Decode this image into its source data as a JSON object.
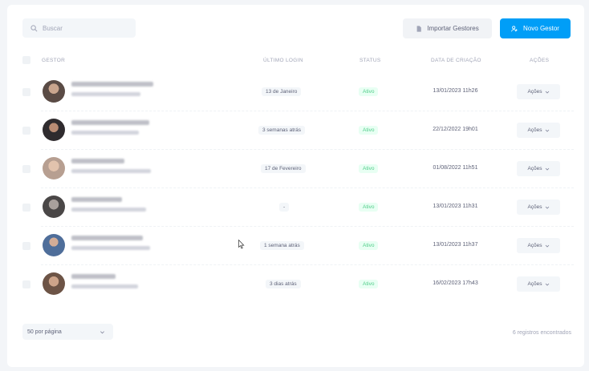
{
  "search": {
    "placeholder": "Buscar"
  },
  "toolbar": {
    "import_label": "Importar Gestores",
    "new_label": "Novo Gestor"
  },
  "table": {
    "headers": {
      "manager": "GESTOR",
      "last_login": "ÚLTIMO LOGIN",
      "status": "STATUS",
      "created": "DATA DE CRIAÇÃO",
      "actions": "AÇÕES"
    },
    "rows": [
      {
        "last_login": "13 de Janeiro",
        "status": "Ativo",
        "created": "13/01/2023 11h26",
        "actions": "Ações"
      },
      {
        "last_login": "3 semanas atrás",
        "status": "Ativo",
        "created": "22/12/2022 19h01",
        "actions": "Ações"
      },
      {
        "last_login": "17 de Fevereiro",
        "status": "Ativo",
        "created": "01/08/2022 11h51",
        "actions": "Ações"
      },
      {
        "last_login": "-",
        "status": "Ativo",
        "created": "13/01/2023 11h31",
        "actions": "Ações"
      },
      {
        "last_login": "1 semana atrás",
        "status": "Ativo",
        "created": "13/01/2023 11h37",
        "actions": "Ações"
      },
      {
        "last_login": "3 dias atrás",
        "status": "Ativo",
        "created": "16/02/2023 17h43",
        "actions": "Ações"
      }
    ]
  },
  "footer": {
    "per_page": "50 por página",
    "count": "6 registros encontrados"
  },
  "colors": {
    "primary": "#009ef7",
    "success_text": "#50cd89",
    "success_bg": "#e8fff3"
  }
}
